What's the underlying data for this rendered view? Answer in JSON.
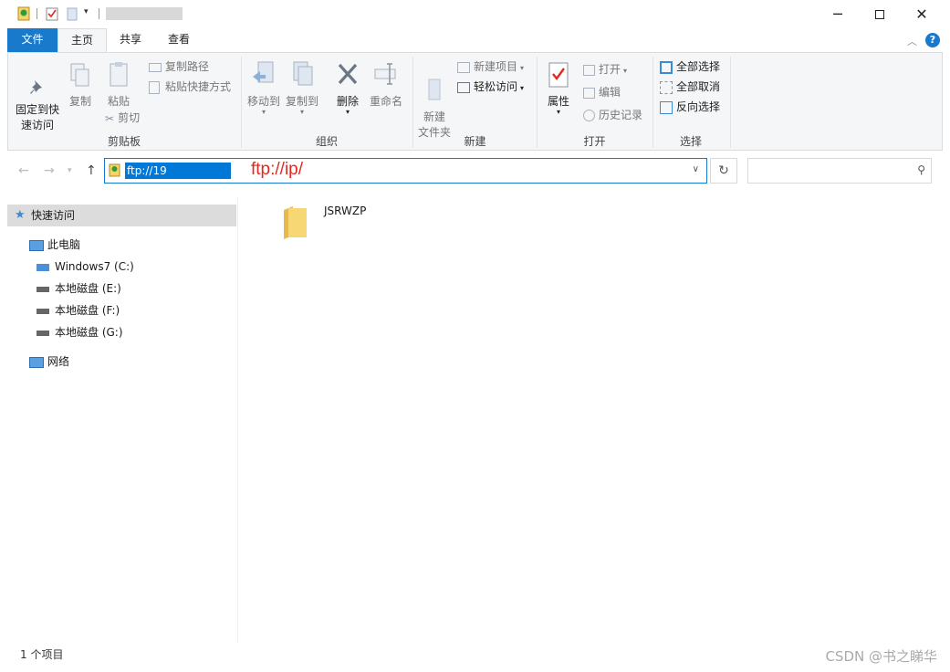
{
  "titlebar": {
    "window_controls": [
      "minimize-icon",
      "maximize-icon",
      "close-icon"
    ]
  },
  "tabs": [
    {
      "label": "文件"
    },
    {
      "label": "主页"
    },
    {
      "label": "共享"
    },
    {
      "label": "查看"
    }
  ],
  "ribbon": {
    "clipboard": {
      "label": "剪贴板",
      "pin": "固定到快\n速访问",
      "copy": "复制",
      "paste": "粘贴",
      "copy_path": "复制路径",
      "paste_shortcut": "粘贴快捷方式",
      "cut": "剪切"
    },
    "organize": {
      "label": "组织",
      "move_to": "移动到",
      "copy_to": "复制到",
      "delete": "删除",
      "rename": "重命名"
    },
    "new": {
      "label": "新建",
      "new_folder": "新建\n文件夹",
      "new_item": "新建项目",
      "easy_access": "轻松访问"
    },
    "open": {
      "label": "打开",
      "properties": "属性",
      "open": "打开",
      "edit": "编辑",
      "history": "历史记录"
    },
    "select": {
      "label": "选择",
      "select_all": "全部选择",
      "select_none": "全部取消",
      "invert": "反向选择"
    }
  },
  "address": {
    "value": "ftp://19",
    "annotation": "ftp://ip/"
  },
  "nav": {
    "quick_access": "快速访问",
    "this_pc": "此电脑",
    "drives": [
      {
        "label": "Windows7 (C:)"
      },
      {
        "label": "本地磁盘 (E:)"
      },
      {
        "label": "本地磁盘 (F:)"
      },
      {
        "label": "本地磁盘 (G:)"
      }
    ],
    "network": "网络"
  },
  "content": {
    "items": [
      {
        "name": "JSRWZP",
        "type": "folder"
      }
    ]
  },
  "status": {
    "count": "1 个项目"
  },
  "watermark": "CSDN @书之睇华",
  "colors": {
    "accent": "#1979ca",
    "selection": "#0078d7",
    "annotation": "#e5281f"
  }
}
